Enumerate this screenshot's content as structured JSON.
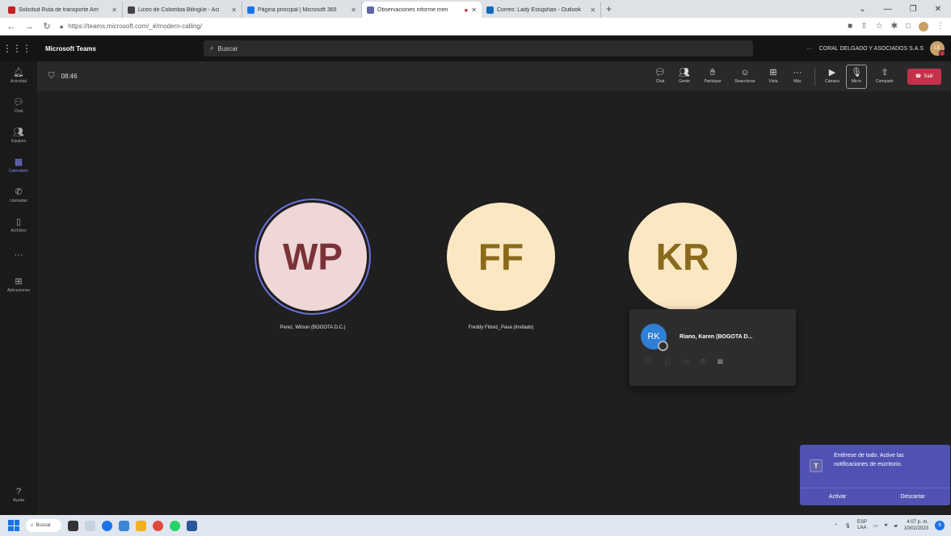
{
  "browser": {
    "tabs": [
      {
        "title": "Solicitud Ruta de transporte Arri",
        "color": "#c5221f",
        "active": false
      },
      {
        "title": "Liceo de Colombia Bilingüe - Aci",
        "color": "#444444",
        "active": false
      },
      {
        "title": "Página principal | Microsoft 365",
        "color": "#1a73e8",
        "active": false
      },
      {
        "title": "Observaciones informe men",
        "color": "#6264a7",
        "active": true
      },
      {
        "title": "Correo: Lady Estupiñan - Outlook",
        "color": "#0f6cbd",
        "active": false
      }
    ],
    "new_tab": "+",
    "url": "https://teams.microsoft.com/_#/modern-calling/"
  },
  "teams": {
    "app_title": "Microsoft Teams",
    "search_placeholder": "Buscar",
    "org_name": "CORAL DELGADO Y ASOCIADOS S.A.S",
    "org_more": "···",
    "user_initials": "LE"
  },
  "rail": [
    {
      "label": "Actividad",
      "icon": "bell-icon",
      "glyph": "🔔︎"
    },
    {
      "label": "Chat",
      "icon": "chat-icon",
      "glyph": "💬︎"
    },
    {
      "label": "Equipos",
      "icon": "teams-icon",
      "glyph": "👥︎"
    },
    {
      "label": "Calendario",
      "icon": "calendar-icon",
      "glyph": "▦"
    },
    {
      "label": "Llamadas",
      "icon": "phone-icon",
      "glyph": "✆"
    },
    {
      "label": "Archivos",
      "icon": "file-icon",
      "glyph": "▯"
    },
    {
      "label": "",
      "icon": "more-icon",
      "glyph": "···"
    },
    {
      "label": "Aplicaciones",
      "icon": "apps-icon",
      "glyph": "⊞"
    }
  ],
  "rail_help": {
    "label": "Ayuda",
    "glyph": "?"
  },
  "meeting": {
    "timer": "08:46",
    "controls": [
      {
        "label": "Chat",
        "glyph": "💬︎",
        "name": "chat"
      },
      {
        "label": "Gente",
        "glyph": "👥︎",
        "name": "people"
      },
      {
        "label": "Participar",
        "glyph": "✋︎",
        "name": "raise-hand"
      },
      {
        "label": "Reaccionar",
        "glyph": "☺",
        "name": "react"
      },
      {
        "label": "Vista",
        "glyph": "⊞",
        "name": "view"
      },
      {
        "label": "Más",
        "glyph": "···",
        "name": "more"
      }
    ],
    "media": [
      {
        "label": "Cámara",
        "glyph": "▶",
        "name": "camera"
      },
      {
        "label": "Micro",
        "glyph": "🎙︎",
        "name": "mic"
      },
      {
        "label": "Compartir",
        "glyph": "⇪",
        "name": "share"
      }
    ],
    "leave_label": "Salir",
    "leave_glyph": "☎"
  },
  "participants": [
    {
      "initials": "WP",
      "name": "Perez, Wilson (BOGOTA D.C.)"
    },
    {
      "initials": "FF",
      "name": "Freddy Flórez_Pava (Invitado)"
    },
    {
      "initials": "KR",
      "name": ""
    }
  ],
  "hover_card": {
    "initials": "RK",
    "name": "Riano, Karen (BOGOTA D..."
  },
  "toast": {
    "logo": "T",
    "message": "Entérese de todo. Active las notificaciones de escritorio.",
    "activate": "Activar",
    "dismiss": "Descartar"
  },
  "taskbar": {
    "search": "Buscar",
    "lang": "ESP",
    "lang2": "LAA",
    "time": "4:07 p. m.",
    "date": "10/02/2023",
    "notif_count": "6"
  }
}
